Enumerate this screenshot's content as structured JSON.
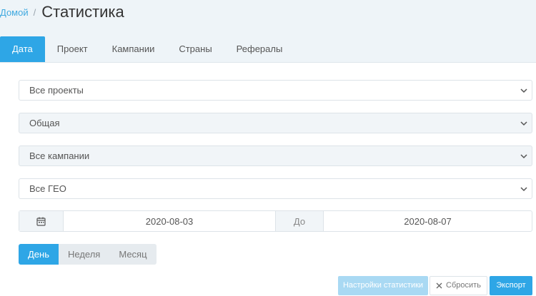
{
  "breadcrumb": {
    "home": "Домой",
    "separator": "/"
  },
  "page_title": "Статистика",
  "tabs": [
    {
      "label": "Дата",
      "active": true
    },
    {
      "label": "Проект",
      "active": false
    },
    {
      "label": "Кампании",
      "active": false
    },
    {
      "label": "Страны",
      "active": false
    },
    {
      "label": "Рефералы",
      "active": false
    }
  ],
  "filters": {
    "project": "Все проекты",
    "type": "Общая",
    "campaign": "Все кампании",
    "geo": "Все ГЕО"
  },
  "dates": {
    "from": "2020-08-03",
    "to_label": "До",
    "to": "2020-08-07",
    "icon": "calendar-icon"
  },
  "period": [
    {
      "label": "День",
      "active": true
    },
    {
      "label": "Неделя",
      "active": false
    },
    {
      "label": "Месяц",
      "active": false
    }
  ],
  "actions": {
    "settings": "Настройки статистики",
    "reset": "Сбросить",
    "reset_icon": "close-icon",
    "export": "Экспорт"
  },
  "colors": {
    "accent": "#2ea6e6",
    "page_bg": "#eef4f8",
    "settings_bg": "#a9d9f3"
  }
}
